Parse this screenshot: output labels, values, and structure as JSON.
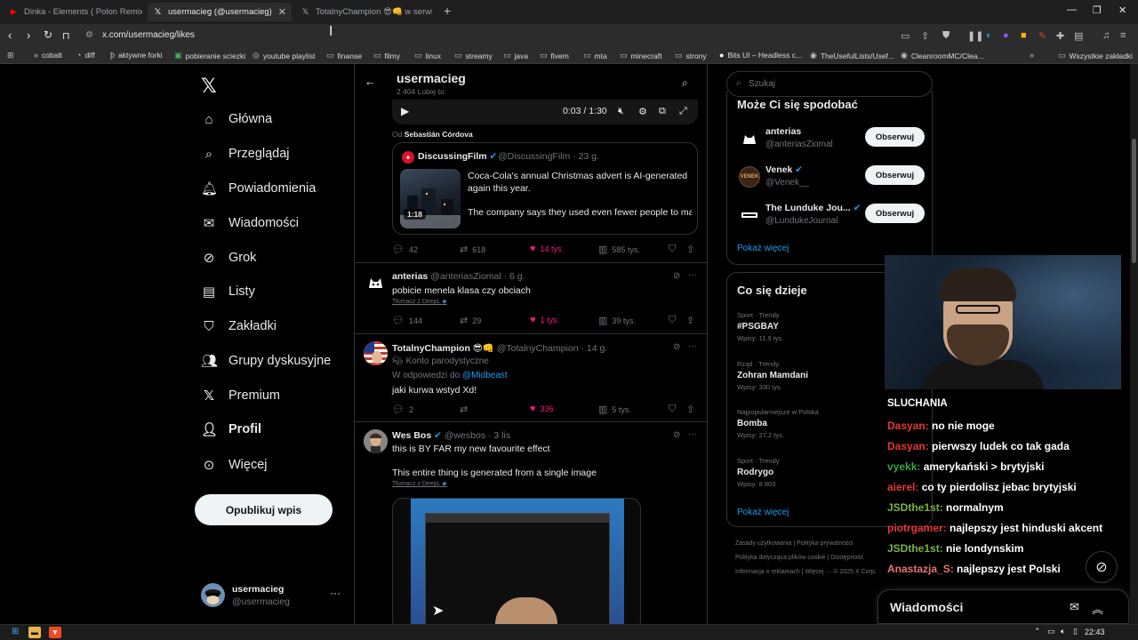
{
  "browser": {
    "tabs": [
      {
        "title": "Dinka - Elements ( Polon Remix ) - Y",
        "icon": "youtube-icon"
      },
      {
        "title": "usermacieg (@usermacieg) / X",
        "icon": "x-icon"
      },
      {
        "title": "TotalnyChampion 😎👊 w serwisie X",
        "icon": "x-icon"
      }
    ],
    "url": "x.com/usermacieg/likes",
    "bookmarks": [
      "cobalt",
      "diff",
      "aktywne forki",
      "pobieranie sciezki",
      "youtube playlist",
      "finanse",
      "filmy",
      "linux",
      "streamy",
      "java",
      "fivem",
      "mta",
      "minecraft",
      "strony",
      "Bits UI – Headless c...",
      "TheUsefulLists/Usef...",
      "CleanroomMC/Clea..."
    ],
    "other_bookmarks": "Wszystkie zakładki"
  },
  "nav": {
    "items": [
      {
        "label": "Główna",
        "icon": "home-icon"
      },
      {
        "label": "Przeglądaj",
        "icon": "search-icon"
      },
      {
        "label": "Powiadomienia",
        "icon": "bell-icon"
      },
      {
        "label": "Wiadomości",
        "icon": "mail-icon"
      },
      {
        "label": "Grok",
        "icon": "grok-icon"
      },
      {
        "label": "Listy",
        "icon": "list-icon"
      },
      {
        "label": "Zakładki",
        "icon": "bookmark-icon"
      },
      {
        "label": "Grupy dyskusyjne",
        "icon": "community-icon"
      },
      {
        "label": "Premium",
        "icon": "x-icon"
      },
      {
        "label": "Profil",
        "icon": "profile-icon"
      },
      {
        "label": "Więcej",
        "icon": "more-circle-icon"
      }
    ],
    "post_button": "Opublikuj wpis",
    "account": {
      "name": "usermacieg",
      "handle": "@usermacieg"
    }
  },
  "header": {
    "title": "usermacieg",
    "subtitle": "2 404 Lubię to"
  },
  "player": {
    "time": "0:03 / 1:30"
  },
  "from": {
    "prefix": "Od",
    "name": "Sebastián Córdova"
  },
  "quote": {
    "name": "DiscussingFilm",
    "handle_time": "@DiscussingFilm · 23 g.",
    "duration": "1:18",
    "text1": "Coca-Cola's annual Christmas advert is AI-generated again this year.",
    "text2": "The company says they used even fewer people to make it — \"We need to keep moving forward and ..."
  },
  "first_actions": {
    "replies": "42",
    "reposts": "618",
    "likes": "14 tys.",
    "views": "585 tys."
  },
  "tweets": [
    {
      "name": "anterias",
      "handle_time": "@anteriasZiomal · 6 g.",
      "text": "pobicie menela klasa czy obciach",
      "translate": "Tłumacz z DeepL",
      "replies": "144",
      "reposts": "29",
      "likes": "1 tys.",
      "views": "39 tys."
    },
    {
      "name": "TotalnyChampion 😎👊",
      "handle_time": "@TotalnyChampion · 14 g.",
      "label": "Konto parodystyczne",
      "reply_prefix": "W odpowiedzi do",
      "reply_to": "@Midbeast",
      "text": "jaki kurwa wstyd Xd!",
      "replies": "2",
      "reposts": "",
      "likes": "336",
      "views": "5 tys."
    },
    {
      "name": "Wes Bos",
      "handle_time": "@wesbos · 3 lis",
      "text": "this is BY FAR my new favourite effect",
      "text2": "This entire thing is generated from a single image",
      "translate": "Tłumacz z DeepL"
    }
  ],
  "right": {
    "search_placeholder": "Szukaj",
    "suggest_title": "Może Ci się spodobać",
    "suggestions": [
      {
        "name": "anterias",
        "handle": "@anteriasZiomal",
        "button": "Obserwuj"
      },
      {
        "name": "Venek",
        "handle": "@Venek__",
        "button": "Obserwuj"
      },
      {
        "name": "The Lunduke Jou...",
        "handle": "@LundukeJournal",
        "button": "Obserwuj"
      }
    ],
    "show_more": "Pokaż więcej",
    "trends_title": "Co się dzieje",
    "trends": [
      {
        "category": "Sport · Trendy",
        "topic": "#PSGBAY",
        "posts": "Wpisy: 11,9 tys."
      },
      {
        "category": "Rząd · Trendy",
        "topic": "Zohran Mamdani",
        "posts": "Wpisy: 330 tys."
      },
      {
        "category": "Najpopularniejsze w Polska",
        "topic": "Bomba",
        "posts": "Wpisy: 27,2 tys."
      },
      {
        "category": "Sport · Trendy",
        "topic": "Rodrygo",
        "posts": "Wpisy: 8 803"
      }
    ],
    "trends_more": "Pokaż więcej",
    "footer": [
      "Zasady użytkowania",
      "Polityka prywatności",
      "Polityka dotycząca plików cookie",
      "Dostępność",
      "Informacja o reklamach",
      "Więcej ···",
      "© 2025 X Corp."
    ]
  },
  "chat": {
    "title": "SLUCHANIA",
    "messages": [
      {
        "user": "Dasyan:",
        "text": "no nie moge",
        "color": "#e53935"
      },
      {
        "user": "Dasyan:",
        "text": "pierwszy ludek co tak gada",
        "color": "#e53935"
      },
      {
        "user": "vyekk:",
        "text": "amerykański > brytyjski",
        "color": "#43a047"
      },
      {
        "user": "aierel:",
        "text": "co ty pierdolisz jebac brytyjski",
        "color": "#e53935"
      },
      {
        "user": "JSDthe1st:",
        "text": "normalnym",
        "color": "#7cb342"
      },
      {
        "user": "piotrgamer:",
        "text": "najlepszy jest hinduski akcent",
        "color": "#e53935"
      },
      {
        "user": "JSDthe1st:",
        "text": "nie londynskim",
        "color": "#7cb342"
      },
      {
        "user": "Anastazja_S:",
        "text": "najlepszy jest Polski",
        "color": "#e57373"
      }
    ]
  },
  "messages_bar": {
    "title": "Wiadomości"
  },
  "taskbar": {
    "time": "22:43"
  },
  "colors": {
    "accent": "#1d9bf0",
    "like": "#f91880",
    "bg": "#000000",
    "border": "#2f3336"
  }
}
